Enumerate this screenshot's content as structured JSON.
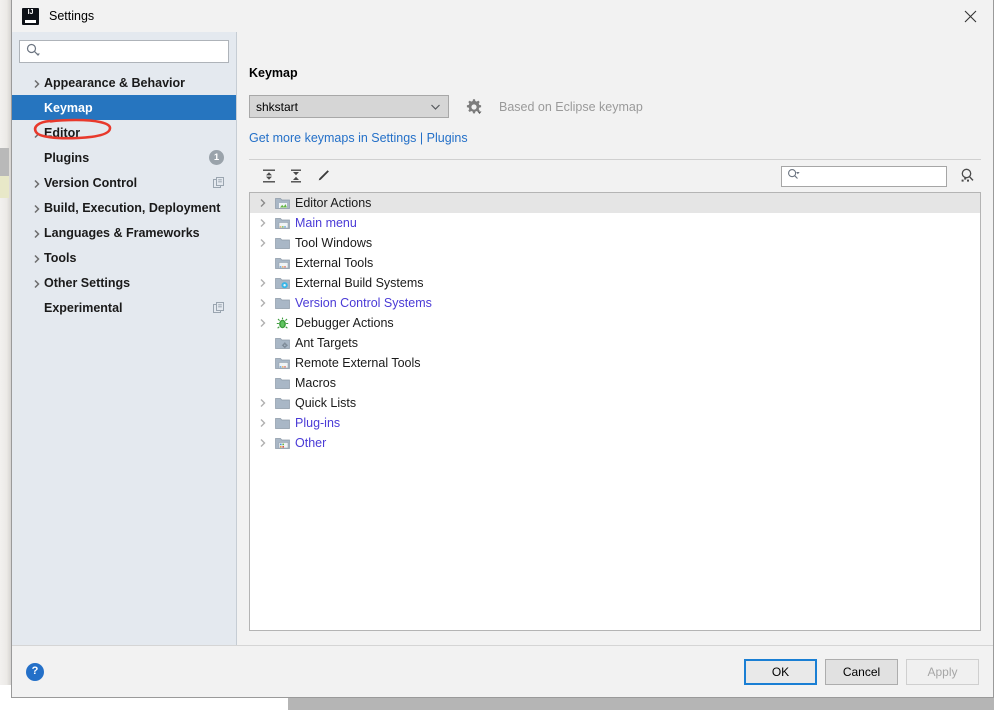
{
  "window": {
    "title": "Settings",
    "logo_icon": "intellij-idea-logo-icon",
    "close_icon": "close-icon"
  },
  "sidebar": {
    "search": {
      "value": "",
      "placeholder": "",
      "icon": "search-dropdown-icon"
    },
    "items": [
      {
        "label": "Appearance & Behavior",
        "has_arrow": true,
        "selected": false,
        "badge": null,
        "badge_icon": null
      },
      {
        "label": "Keymap",
        "has_arrow": false,
        "selected": true,
        "badge": null,
        "badge_icon": null
      },
      {
        "label": "Editor",
        "has_arrow": true,
        "selected": false,
        "badge": null,
        "badge_icon": null
      },
      {
        "label": "Plugins",
        "has_arrow": false,
        "selected": false,
        "badge": "1",
        "badge_icon": null
      },
      {
        "label": "Version Control",
        "has_arrow": true,
        "selected": false,
        "badge": null,
        "badge_icon": "project-scope-icon"
      },
      {
        "label": "Build, Execution, Deployment",
        "has_arrow": true,
        "selected": false,
        "badge": null,
        "badge_icon": null
      },
      {
        "label": "Languages & Frameworks",
        "has_arrow": true,
        "selected": false,
        "badge": null,
        "badge_icon": null
      },
      {
        "label": "Tools",
        "has_arrow": true,
        "selected": false,
        "badge": null,
        "badge_icon": null
      },
      {
        "label": "Other Settings",
        "has_arrow": true,
        "selected": false,
        "badge": null,
        "badge_icon": null
      },
      {
        "label": "Experimental",
        "has_arrow": false,
        "selected": false,
        "badge": null,
        "badge_icon": "project-scope-icon"
      }
    ],
    "annotation": {
      "shape": "red-ellipse",
      "color": "#e8392c",
      "targets": "Keymap"
    }
  },
  "content": {
    "title": "Keymap",
    "keymap_select": {
      "value": "shkstart",
      "chevron_icon": "chevron-down-icon"
    },
    "gear_icon": "gear-with-dropdown-icon",
    "based_on_text": "Based on Eclipse keymap",
    "more_keymaps_link": "Get more keymaps in Settings | Plugins",
    "toolbar": {
      "expand_all_icon": "expand-all-icon",
      "collapse_all_icon": "collapse-all-icon",
      "edit_shortcut_icon": "edit-pencil-icon",
      "search": {
        "value": "",
        "placeholder": "",
        "icon": "search-dropdown-icon"
      },
      "find_by_shortcut_icon": "find-by-shortcut-icon"
    },
    "tree": [
      {
        "label": "Editor Actions",
        "has_arrow": true,
        "icon": "folder-editor-icon",
        "link": false,
        "selected": true
      },
      {
        "label": "Main menu",
        "has_arrow": true,
        "icon": "folder-menu-icon",
        "link": true,
        "selected": false
      },
      {
        "label": "Tool Windows",
        "has_arrow": true,
        "icon": "folder-icon",
        "link": false,
        "selected": false
      },
      {
        "label": "External Tools",
        "has_arrow": false,
        "icon": "folder-external-tools-icon",
        "link": false,
        "selected": false
      },
      {
        "label": "External Build Systems",
        "has_arrow": true,
        "icon": "folder-build-icon",
        "link": false,
        "selected": false
      },
      {
        "label": "Version Control Systems",
        "has_arrow": true,
        "icon": "folder-icon",
        "link": true,
        "selected": false
      },
      {
        "label": "Debugger Actions",
        "has_arrow": true,
        "icon": "debugger-bug-icon",
        "link": false,
        "selected": false
      },
      {
        "label": "Ant Targets",
        "has_arrow": false,
        "icon": "folder-ant-icon",
        "link": false,
        "selected": false
      },
      {
        "label": "Remote External Tools",
        "has_arrow": false,
        "icon": "folder-external-tools-icon",
        "link": false,
        "selected": false
      },
      {
        "label": "Macros",
        "has_arrow": false,
        "icon": "folder-icon",
        "link": false,
        "selected": false
      },
      {
        "label": "Quick Lists",
        "has_arrow": true,
        "icon": "folder-icon",
        "link": false,
        "selected": false
      },
      {
        "label": "Plug-ins",
        "has_arrow": true,
        "icon": "folder-icon",
        "link": true,
        "selected": false
      },
      {
        "label": "Other",
        "has_arrow": true,
        "icon": "folder-other-icon",
        "link": true,
        "selected": false
      }
    ]
  },
  "footer": {
    "help_icon": "help-question-icon",
    "help_label": "?",
    "ok_label": "OK",
    "cancel_label": "Cancel",
    "apply_label": "Apply"
  },
  "colors": {
    "selection_blue": "#2675bf",
    "link_blue": "#2470c8",
    "tree_link": "#4a3ad6",
    "annotation_red": "#e8392c",
    "sidebar_bg": "#e4e9ef",
    "dialog_bg": "#f2f2f2"
  }
}
